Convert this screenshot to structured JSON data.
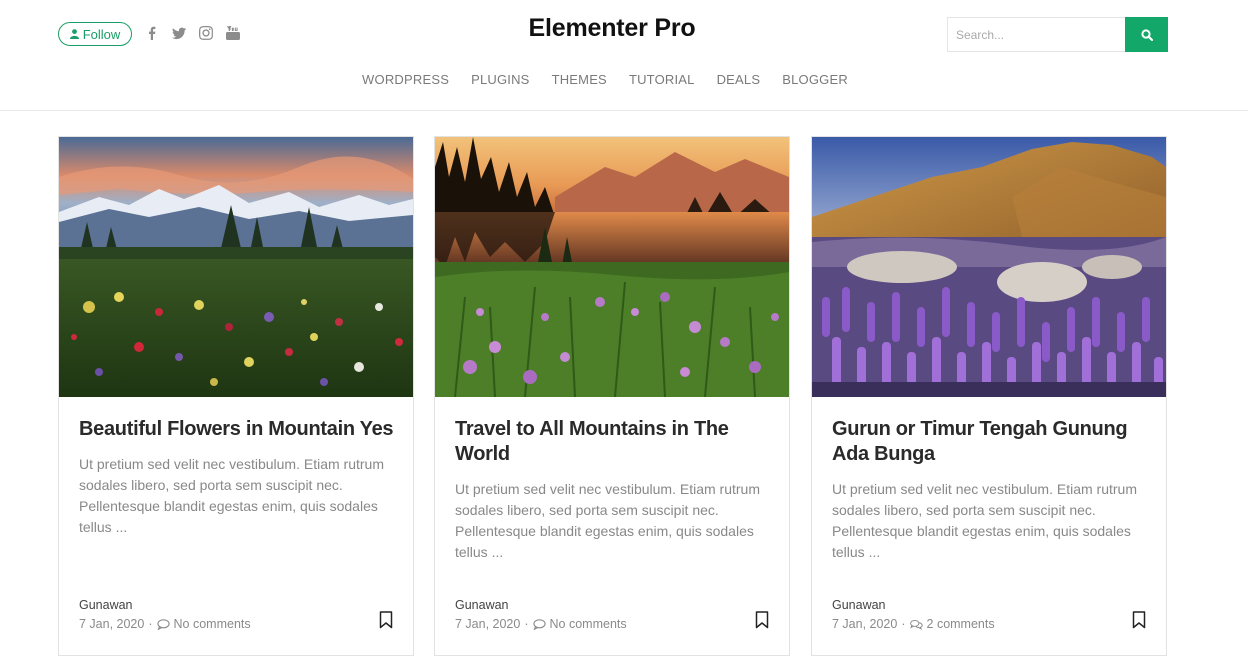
{
  "header": {
    "follow_label": "Follow",
    "site_title": "Elementer Pro",
    "search_placeholder": "Search...",
    "social": [
      "facebook-icon",
      "twitter-icon",
      "instagram-icon",
      "youtube-icon"
    ],
    "nav": [
      "WORDPRESS",
      "PLUGINS",
      "THEMES",
      "TUTORIAL",
      "DEALS",
      "BLOGGER"
    ]
  },
  "colors": {
    "accent": "#13a869",
    "follow_border": "#1a9d66",
    "nav_text": "#7a7a7a",
    "title_text": "#2a2a2a",
    "excerpt_text": "#888888"
  },
  "posts": [
    {
      "title": "Beautiful Flowers in Mountain Yes",
      "excerpt": "Ut pretium sed velit nec vestibulum. Etiam rutrum sodales libero, sed porta sem suscipit nec. Pellentesque blandit egestas enim, quis sodales tellus ...",
      "author": "Gunawan",
      "date": "7 Jan, 2020",
      "comments": "No comments",
      "image": "mountain-wildflower-meadow"
    },
    {
      "title": "Travel to All Mountains in The World",
      "excerpt": "Ut pretium sed velit nec vestibulum. Etiam rutrum sodales libero, sed porta sem suscipit nec. Pellentesque blandit egestas enim, quis sodales tellus ...",
      "author": "Gunawan",
      "date": "7 Jan, 2020",
      "comments": "No comments",
      "image": "lake-sunset-wildflowers"
    },
    {
      "title": "Gurun or Timur Tengah Gunung Ada Bunga",
      "excerpt": "Ut pretium sed velit nec vestibulum. Etiam rutrum sodales libero, sed porta sem suscipit nec. Pellentesque blandit egestas enim, quis sodales tellus ...",
      "author": "Gunawan",
      "date": "7 Jan, 2020",
      "comments": "2 comments",
      "image": "desert-lupine-field"
    }
  ]
}
